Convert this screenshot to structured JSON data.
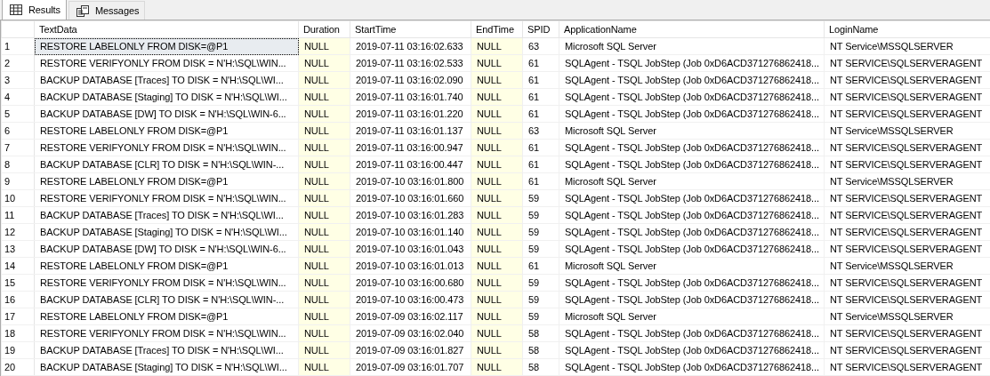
{
  "tabs": [
    {
      "label": "Results",
      "kind": "grid",
      "selected": true
    },
    {
      "label": "Messages",
      "kind": "messages",
      "selected": false
    }
  ],
  "table": {
    "columns": [
      {
        "label": "TextData",
        "shaded": false
      },
      {
        "label": "Duration",
        "shaded": true
      },
      {
        "label": "StartTime",
        "shaded": false
      },
      {
        "label": "EndTime",
        "shaded": true
      },
      {
        "label": "SPID",
        "shaded": false
      },
      {
        "label": "ApplicationName",
        "shaded": false
      },
      {
        "label": "LoginName",
        "shaded": false
      }
    ],
    "rows": [
      {
        "number": "1",
        "focused": true,
        "cells": [
          "RESTORE LABELONLY FROM DISK=@P1",
          "NULL",
          "2019-07-11 03:16:02.633",
          "NULL",
          "63",
          "Microsoft SQL Server",
          "NT Service\\MSSQLSERVER"
        ]
      },
      {
        "number": "2",
        "focused": false,
        "cells": [
          "RESTORE VERIFYONLY FROM DISK = N'H:\\SQL\\WIN...",
          "NULL",
          "2019-07-11 03:16:02.533",
          "NULL",
          "61",
          "SQLAgent - TSQL JobStep (Job 0xD6ACD371276862418...",
          "NT SERVICE\\SQLSERVERAGENT"
        ]
      },
      {
        "number": "3",
        "focused": false,
        "cells": [
          "BACKUP DATABASE [Traces] TO DISK = N'H:\\SQL\\WI...",
          "NULL",
          "2019-07-11 03:16:02.090",
          "NULL",
          "61",
          "SQLAgent - TSQL JobStep (Job 0xD6ACD371276862418...",
          "NT SERVICE\\SQLSERVERAGENT"
        ]
      },
      {
        "number": "4",
        "focused": false,
        "cells": [
          "BACKUP DATABASE [Staging] TO DISK = N'H:\\SQL\\WI...",
          "NULL",
          "2019-07-11 03:16:01.740",
          "NULL",
          "61",
          "SQLAgent - TSQL JobStep (Job 0xD6ACD371276862418...",
          "NT SERVICE\\SQLSERVERAGENT"
        ]
      },
      {
        "number": "5",
        "focused": false,
        "cells": [
          "BACKUP DATABASE [DW] TO DISK = N'H:\\SQL\\WIN-6...",
          "NULL",
          "2019-07-11 03:16:01.220",
          "NULL",
          "61",
          "SQLAgent - TSQL JobStep (Job 0xD6ACD371276862418...",
          "NT SERVICE\\SQLSERVERAGENT"
        ]
      },
      {
        "number": "6",
        "focused": false,
        "cells": [
          "RESTORE LABELONLY FROM DISK=@P1",
          "NULL",
          "2019-07-11 03:16:01.137",
          "NULL",
          "63",
          "Microsoft SQL Server",
          "NT Service\\MSSQLSERVER"
        ]
      },
      {
        "number": "7",
        "focused": false,
        "cells": [
          "RESTORE VERIFYONLY FROM DISK = N'H:\\SQL\\WIN...",
          "NULL",
          "2019-07-11 03:16:00.947",
          "NULL",
          "61",
          "SQLAgent - TSQL JobStep (Job 0xD6ACD371276862418...",
          "NT SERVICE\\SQLSERVERAGENT"
        ]
      },
      {
        "number": "8",
        "focused": false,
        "cells": [
          "BACKUP DATABASE [CLR] TO DISK = N'H:\\SQL\\WIN-...",
          "NULL",
          "2019-07-11 03:16:00.447",
          "NULL",
          "61",
          "SQLAgent - TSQL JobStep (Job 0xD6ACD371276862418...",
          "NT SERVICE\\SQLSERVERAGENT"
        ]
      },
      {
        "number": "9",
        "focused": false,
        "cells": [
          "RESTORE LABELONLY FROM DISK=@P1",
          "NULL",
          "2019-07-10 03:16:01.800",
          "NULL",
          "61",
          "Microsoft SQL Server",
          "NT Service\\MSSQLSERVER"
        ]
      },
      {
        "number": "10",
        "focused": false,
        "cells": [
          "RESTORE VERIFYONLY FROM DISK = N'H:\\SQL\\WIN...",
          "NULL",
          "2019-07-10 03:16:01.660",
          "NULL",
          "59",
          "SQLAgent - TSQL JobStep (Job 0xD6ACD371276862418...",
          "NT SERVICE\\SQLSERVERAGENT"
        ]
      },
      {
        "number": "11",
        "focused": false,
        "cells": [
          "BACKUP DATABASE [Traces] TO DISK = N'H:\\SQL\\WI...",
          "NULL",
          "2019-07-10 03:16:01.283",
          "NULL",
          "59",
          "SQLAgent - TSQL JobStep (Job 0xD6ACD371276862418...",
          "NT SERVICE\\SQLSERVERAGENT"
        ]
      },
      {
        "number": "12",
        "focused": false,
        "cells": [
          "BACKUP DATABASE [Staging] TO DISK = N'H:\\SQL\\WI...",
          "NULL",
          "2019-07-10 03:16:01.140",
          "NULL",
          "59",
          "SQLAgent - TSQL JobStep (Job 0xD6ACD371276862418...",
          "NT SERVICE\\SQLSERVERAGENT"
        ]
      },
      {
        "number": "13",
        "focused": false,
        "cells": [
          "BACKUP DATABASE [DW] TO DISK = N'H:\\SQL\\WIN-6...",
          "NULL",
          "2019-07-10 03:16:01.043",
          "NULL",
          "59",
          "SQLAgent - TSQL JobStep (Job 0xD6ACD371276862418...",
          "NT SERVICE\\SQLSERVERAGENT"
        ]
      },
      {
        "number": "14",
        "focused": false,
        "cells": [
          "RESTORE LABELONLY FROM DISK=@P1",
          "NULL",
          "2019-07-10 03:16:01.013",
          "NULL",
          "61",
          "Microsoft SQL Server",
          "NT Service\\MSSQLSERVER"
        ]
      },
      {
        "number": "15",
        "focused": false,
        "cells": [
          "RESTORE VERIFYONLY FROM DISK = N'H:\\SQL\\WIN...",
          "NULL",
          "2019-07-10 03:16:00.680",
          "NULL",
          "59",
          "SQLAgent - TSQL JobStep (Job 0xD6ACD371276862418...",
          "NT SERVICE\\SQLSERVERAGENT"
        ]
      },
      {
        "number": "16",
        "focused": false,
        "cells": [
          "BACKUP DATABASE [CLR] TO DISK = N'H:\\SQL\\WIN-...",
          "NULL",
          "2019-07-10 03:16:00.473",
          "NULL",
          "59",
          "SQLAgent - TSQL JobStep (Job 0xD6ACD371276862418...",
          "NT SERVICE\\SQLSERVERAGENT"
        ]
      },
      {
        "number": "17",
        "focused": false,
        "cells": [
          "RESTORE LABELONLY FROM DISK=@P1",
          "NULL",
          "2019-07-09 03:16:02.117",
          "NULL",
          "59",
          "Microsoft SQL Server",
          "NT Service\\MSSQLSERVER"
        ]
      },
      {
        "number": "18",
        "focused": false,
        "cells": [
          "RESTORE VERIFYONLY FROM DISK = N'H:\\SQL\\WIN...",
          "NULL",
          "2019-07-09 03:16:02.040",
          "NULL",
          "58",
          "SQLAgent - TSQL JobStep (Job 0xD6ACD371276862418...",
          "NT SERVICE\\SQLSERVERAGENT"
        ]
      },
      {
        "number": "19",
        "focused": false,
        "cells": [
          "BACKUP DATABASE [Traces] TO DISK = N'H:\\SQL\\WI...",
          "NULL",
          "2019-07-09 03:16:01.827",
          "NULL",
          "58",
          "SQLAgent - TSQL JobStep (Job 0xD6ACD371276862418...",
          "NT SERVICE\\SQLSERVERAGENT"
        ]
      },
      {
        "number": "20",
        "focused": false,
        "cells": [
          "BACKUP DATABASE [Staging] TO DISK = N'H:\\SQL\\WI...",
          "NULL",
          "2019-07-09 03:16:01.707",
          "NULL",
          "58",
          "SQLAgent - TSQL JobStep (Job 0xD6ACD371276862418...",
          "NT SERVICE\\SQLSERVERAGENT"
        ]
      }
    ]
  }
}
